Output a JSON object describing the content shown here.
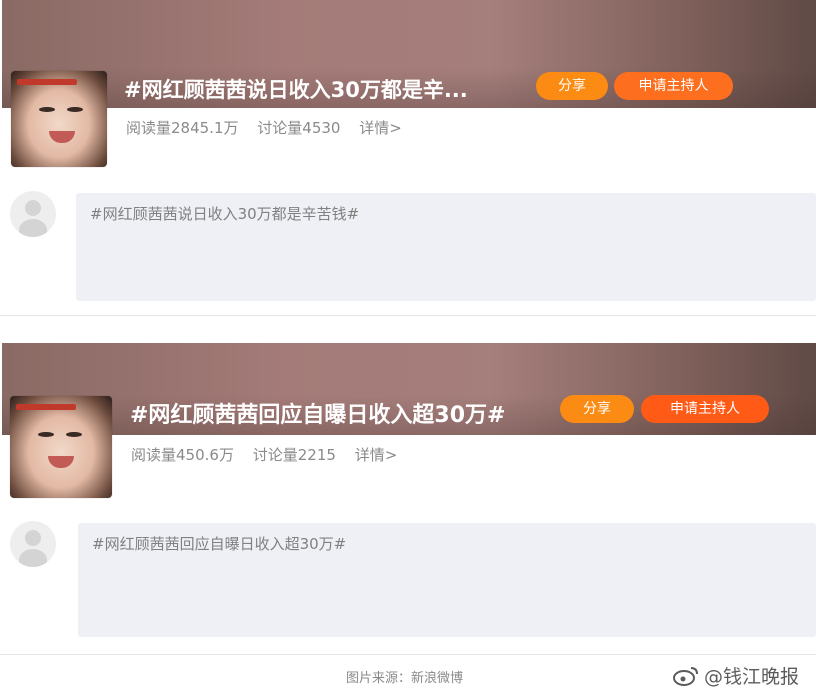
{
  "cards": [
    {
      "title": "#网红顾茜茜说日收入30万都是辛...",
      "share_label": "分享",
      "host_label": "申请主持人",
      "stats": {
        "reads": "阅读量2845.1万",
        "discussions": "讨论量4530",
        "details": "详情>"
      },
      "comment_text": "#网红顾茜茜说日收入30万都是辛苦钱#"
    },
    {
      "title": "#网红顾茜茜回应自曝日收入超30万#",
      "share_label": "分享",
      "host_label": "申请主持人",
      "stats": {
        "reads": "阅读量450.6万",
        "discussions": "讨论量2215",
        "details": "详情>"
      },
      "comment_text": "#网红顾茜茜回应自曝日收入超30万#"
    }
  ],
  "footer": {
    "source": "图片来源：新浪微博",
    "watermark": "@钱江晚报"
  },
  "icons": {
    "weibo": "weibo-logo-icon",
    "avatar": "default-avatar-icon"
  },
  "colors": {
    "share": "#fc8b13",
    "host": "#ff5a16",
    "comment_bg": "#eef0f5"
  }
}
